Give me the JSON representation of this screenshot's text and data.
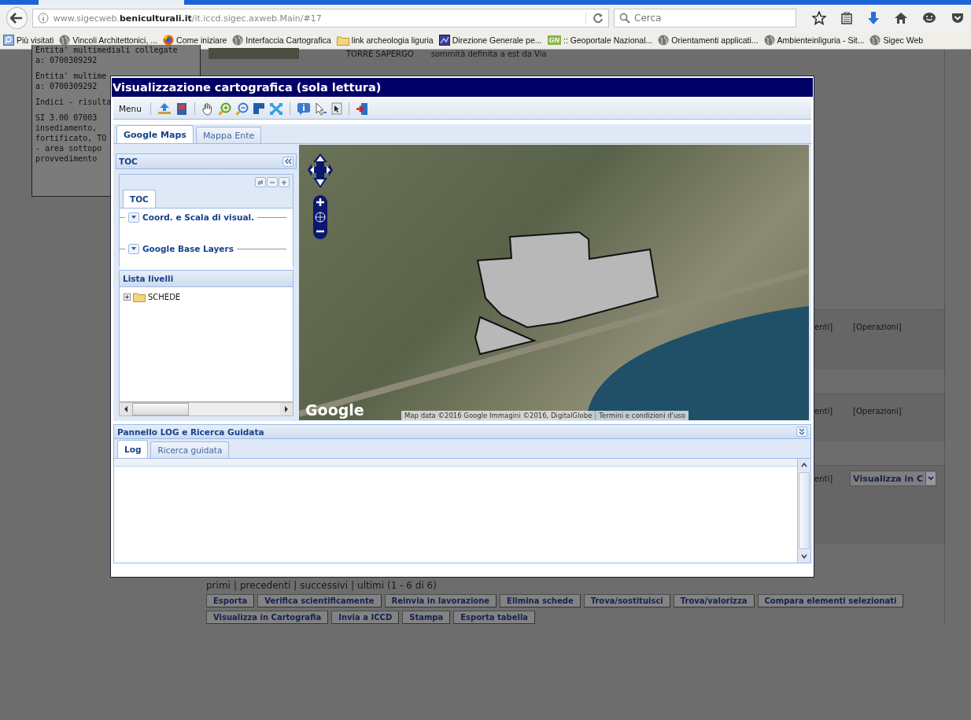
{
  "browser": {
    "url": "www.sigecweb.**beniculturali.it**/it.iccd.sigec.axweb.Main/#17",
    "search": {
      "placeholder": "Cerca"
    },
    "bookmarks": [
      {
        "kind": "search",
        "label": "Più visitati"
      },
      {
        "kind": "globe",
        "label": "Vincoli Architettonici, ..."
      },
      {
        "kind": "firefox",
        "label": "Come iniziare"
      },
      {
        "kind": "globe",
        "label": "Interfaccia Cartografica"
      },
      {
        "kind": "folder",
        "label": "link archeologia liguria"
      },
      {
        "kind": "picture",
        "label": "Direzione Generale pe..."
      },
      {
        "kind": "badge",
        "badge": "GN",
        "label": ":: Geoportale Nazional..."
      },
      {
        "kind": "globe",
        "label": "Orientamenti applicati..."
      },
      {
        "kind": "globe",
        "label": "Ambienteinliguria - Sit..."
      },
      {
        "kind": "globe",
        "label": "Sigec Web"
      }
    ]
  },
  "page": {
    "info_lines": [
      "Entita' multimediali collegate",
      "a: 0700309292",
      "Entita' multime",
      "a: 0700309292",
      "Indici - risulta",
      "SI 3.00 07003",
      "insediamento,",
      "fortificato, TO",
      "- area sottopo",
      "provvedimento"
    ],
    "record": {
      "name": "TORRE SAPERGO",
      "description": "sommità definita a est da Via"
    },
    "right_rows": [
      {
        "kind": "text",
        "cells": [
          "enti]",
          "[Operazioni]"
        ]
      },
      {
        "kind": "text",
        "cells": [
          "enti]",
          "[Operazioni]"
        ]
      },
      {
        "kind": "select",
        "cells": [
          "enti]"
        ],
        "select": "Visualizza in C"
      }
    ],
    "pagination": {
      "links": [
        "primi",
        "precedenti",
        "successivi",
        "ultimi"
      ],
      "separator": "|",
      "range": "(1 - 6 di 6)"
    },
    "buttons": [
      [
        "Esporta",
        "Verifica scientificamente",
        "Reinvia in lavorazione",
        "Elimina schede",
        "Trova/sostituisci",
        "Trova/valorizza",
        "Compara elementi selezionati"
      ],
      [
        "Visualizza in Cartografia",
        "Invia a ICCD",
        "Stampa",
        "Esporta tabella"
      ]
    ]
  },
  "dialog": {
    "title": "Visualizzazione cartografica (sola lettura)",
    "menu": "Menu",
    "tools": [
      {
        "kind": "upload"
      },
      {
        "kind": "book"
      },
      {
        "kind": "sep"
      },
      {
        "kind": "hand"
      },
      {
        "kind": "zoomin"
      },
      {
        "kind": "zoomout"
      },
      {
        "kind": "square"
      },
      {
        "kind": "expand"
      },
      {
        "kind": "sep"
      },
      {
        "kind": "info"
      },
      {
        "kind": "pointer"
      },
      {
        "kind": "cursor"
      },
      {
        "kind": "sep"
      },
      {
        "kind": "exit"
      }
    ],
    "tabs": [
      {
        "label": "Google Maps",
        "selected": true
      },
      {
        "label": "Mappa Ente",
        "selected": false
      }
    ],
    "toc": {
      "title": "TOC",
      "tabs": [
        {
          "label": "TOC",
          "selected": true
        }
      ],
      "groups": [
        {
          "label": "Coord. e Scala di visual.",
          "expanded": true
        },
        {
          "label": "Google Base Layers",
          "expanded": true
        }
      ],
      "layers_title": "Lista livelli",
      "layers": [
        {
          "label": "SCHEDE",
          "expanded": false
        }
      ]
    },
    "map": {
      "logo": "Google",
      "attribution": "Map data ©2016 Google Immagini ©2016, DigitalGlobe",
      "terms": "Termini e condizioni d'uso"
    },
    "log": {
      "title": "Pannello LOG e Ricerca Guidata",
      "tabs": [
        {
          "label": "Log",
          "selected": true
        },
        {
          "label": "Ricerca guidata",
          "selected": false
        }
      ]
    }
  }
}
